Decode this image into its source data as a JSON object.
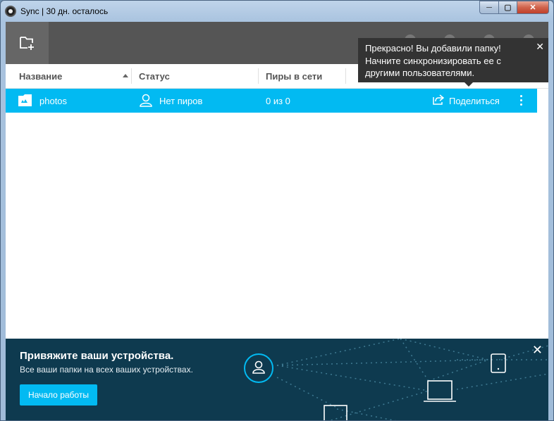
{
  "window": {
    "title": "Sync | 30 дн. осталось"
  },
  "caption": {
    "minimize": "─",
    "maximize": "▢",
    "close": "✕"
  },
  "columns": {
    "name": "Название",
    "status": "Статус",
    "peers": "Пиры в сети"
  },
  "folders": [
    {
      "name": "photos",
      "status": "Нет пиров",
      "peers": "0 из 0",
      "share_label": "Поделиться"
    }
  ],
  "tooltip": {
    "lines": [
      "Прекрасно! Вы добавили папку!",
      "Начните синхронизировать ее с",
      "другими пользователями."
    ],
    "close": "✕"
  },
  "banner": {
    "title": "Привяжите ваши устройства.",
    "subtitle": "Все ваши папки на всех ваших устройствах.",
    "button": "Начало работы",
    "close": "✕"
  },
  "colors": {
    "accent": "#02baf2",
    "toolbar": "#555555",
    "banner": "#0e3a4f",
    "tooltip": "#333333"
  }
}
